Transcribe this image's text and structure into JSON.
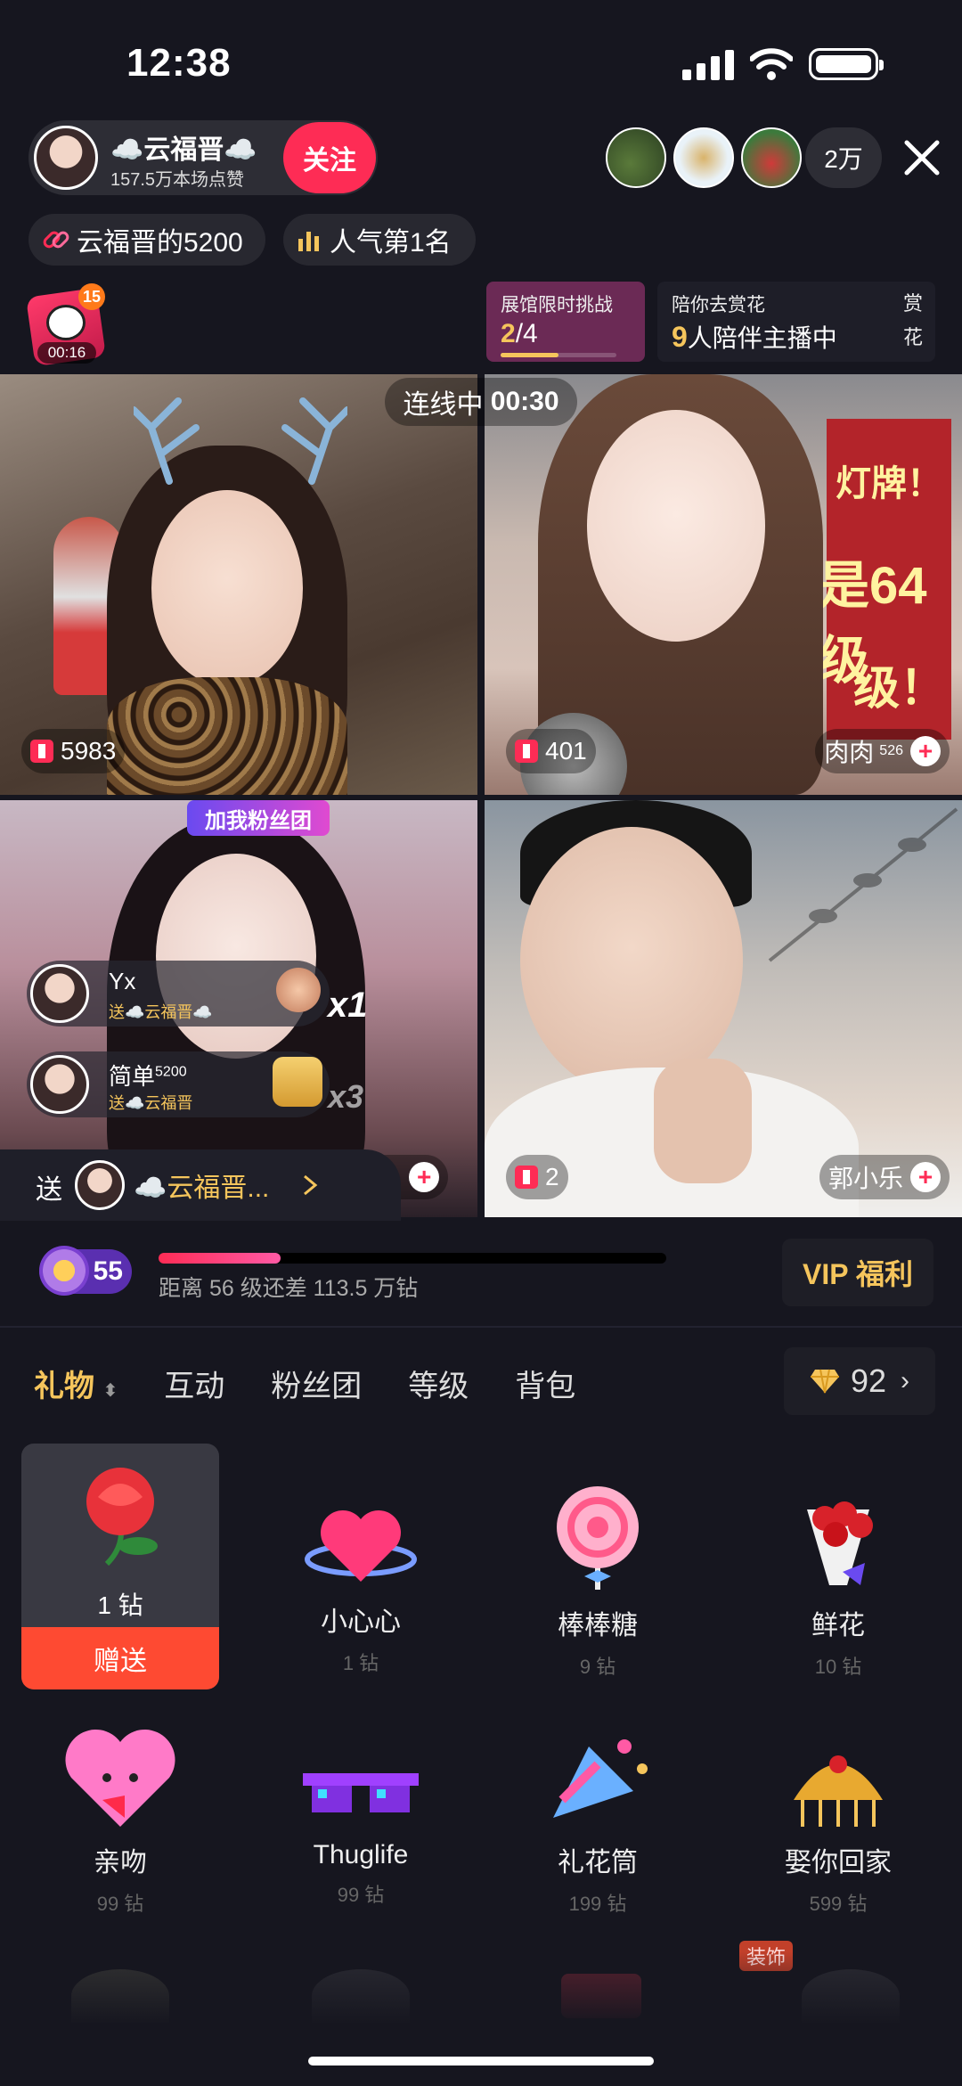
{
  "status_bar": {
    "time": "12:38"
  },
  "host": {
    "name": "☁️云福晋☁️",
    "likes": "157.5万本场点赞",
    "follow_label": "关注"
  },
  "viewers": {
    "count": "2万"
  },
  "chips": {
    "fan_club": "云福晋的5200",
    "popularity": "人气第1名"
  },
  "badge": {
    "number": "15",
    "timer": "00:16"
  },
  "challenge": {
    "title": "展馆限时挑战",
    "progress_current": "2",
    "progress_total": "/4",
    "progress_fraction": 0.5
  },
  "companion": {
    "title": "陪你去赏花",
    "count": "9",
    "text": "人陪伴主播中",
    "side_1": "赏",
    "side_2": "花"
  },
  "linking": {
    "label": "连线中",
    "timer": "00:30"
  },
  "tiles": [
    {
      "score": "5983"
    },
    {
      "score": "401",
      "name": "肉肉",
      "sup": "526",
      "sign_1": "灯牌！",
      "sign_2": "是64级",
      "sign_3": "级！"
    },
    {
      "banner": "加我粉丝团",
      "name_short": "/..."
    },
    {
      "score": "2",
      "name": "郭小乐"
    }
  ],
  "gift_messages": [
    {
      "user": "Yx",
      "action": "送☁️云福晋☁️",
      "multiplier": "x1"
    },
    {
      "user": "简单",
      "user_sup": "5200",
      "action": "送☁️云福晋",
      "multiplier": "x3"
    }
  ],
  "send_to": {
    "prefix": "送",
    "target": "☁️云福晋..."
  },
  "level": {
    "value": "55",
    "progress_fraction": 0.24,
    "text": "距离 56 级还差 113.5 万钻",
    "vip_label": "VIP 福利"
  },
  "tabs": [
    {
      "label": "礼物",
      "active": true
    },
    {
      "label": "互动"
    },
    {
      "label": "粉丝团"
    },
    {
      "label": "等级"
    },
    {
      "label": "背包"
    }
  ],
  "balance": {
    "value": "92"
  },
  "gifts": [
    {
      "name": "1 钻",
      "send_label": "赠送",
      "selected": true
    },
    {
      "name": "小心心",
      "price": "1 钻"
    },
    {
      "name": "棒棒糖",
      "price": "9 钻"
    },
    {
      "name": "鲜花",
      "price": "10 钻"
    },
    {
      "name": "亲吻",
      "price": "99 钻"
    },
    {
      "name": "Thuglife",
      "price": "99 钻"
    },
    {
      "name": "礼花筒",
      "price": "199 钻"
    },
    {
      "name": "娶你回家",
      "price": "599 钻"
    }
  ],
  "row3_tag": "装饰",
  "colors": {
    "accent": "#fe2c55",
    "gold": "#f5c55c",
    "background": "#16161f"
  }
}
